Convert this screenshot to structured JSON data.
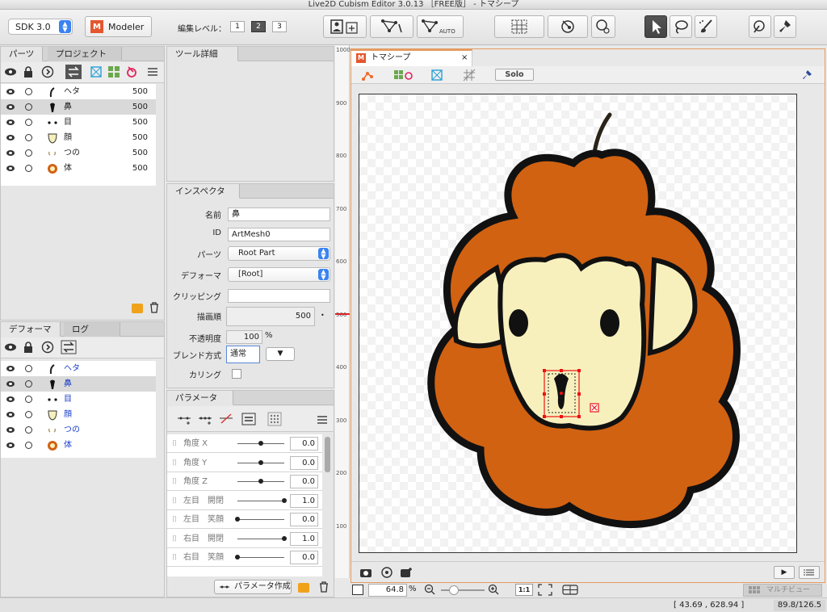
{
  "window": {
    "title": "Live2D Cubism Editor 3.0.13 ［FREE版］ - トマシープ"
  },
  "toolbar": {
    "sdk_value": "SDK 3.0",
    "modeler_label": "Modeler",
    "edit_level_label": "編集レベル：",
    "edit_levels": [
      "1",
      "2",
      "3"
    ],
    "edit_level_selected": "2",
    "auto_label": "AUTO"
  },
  "parts_panel": {
    "tabs": [
      "パーツ",
      "プロジェクト"
    ],
    "items": [
      {
        "name": "ヘタ",
        "value": "500"
      },
      {
        "name": "鼻",
        "value": "500"
      },
      {
        "name": "目",
        "value": "500"
      },
      {
        "name": "顔",
        "value": "500"
      },
      {
        "name": "つの",
        "value": "500"
      },
      {
        "name": "体",
        "value": "500"
      }
    ]
  },
  "tool_detail": {
    "tab": "ツール詳細"
  },
  "inspector": {
    "tab": "インスペクタ",
    "name_label": "名前",
    "name_value": "鼻",
    "id_label": "ID",
    "id_value": "ArtMesh0",
    "part_label": "パーツ",
    "part_value": "Root Part",
    "deformer_label": "デフォーマ",
    "deformer_value": "[Root]",
    "clipping_label": "クリッピング",
    "clipping_value": "",
    "draw_order_label": "描画順",
    "draw_order_value": "500",
    "opacity_label": "不透明度",
    "opacity_value": "100",
    "opacity_unit": "%",
    "blend_label": "ブレンド方式",
    "blend_value": "通常",
    "culling_label": "カリング"
  },
  "deformer_panel": {
    "tabs": [
      "デフォーマ",
      "ログ"
    ],
    "items": [
      {
        "name": "ヘタ"
      },
      {
        "name": "鼻"
      },
      {
        "name": "目"
      },
      {
        "name": "顔"
      },
      {
        "name": "つの"
      },
      {
        "name": "体"
      }
    ]
  },
  "parameter_panel": {
    "tab": "パラメータ",
    "create_label": "パラメータ作成",
    "items": [
      {
        "name": "角度 X",
        "value": "0.0",
        "pos": 0.5
      },
      {
        "name": "角度 Y",
        "value": "0.0",
        "pos": 0.5
      },
      {
        "name": "角度 Z",
        "value": "0.0",
        "pos": 0.5
      },
      {
        "name": "左目　開閉",
        "value": "1.0",
        "pos": 1.0
      },
      {
        "name": "左目　笑顔",
        "value": "0.0",
        "pos": 0.0
      },
      {
        "name": "右目　開閉",
        "value": "1.0",
        "pos": 1.0
      },
      {
        "name": "右目　笑顔",
        "value": "0.0",
        "pos": 0.0
      }
    ]
  },
  "ruler": {
    "labels": [
      "1000",
      "900",
      "800",
      "700",
      "600",
      "500",
      "400",
      "300",
      "200",
      "100"
    ]
  },
  "viewport": {
    "tab_title": "トマシープ",
    "solo_label": "Solo",
    "zoom_value": "64.8",
    "zoom_unit": "%",
    "one_to_one": "1:1",
    "multiview_label": "マルチビュー"
  },
  "status": {
    "coords": "[ 43.69 , 628.94 ]",
    "memory": "89.8/126.5"
  }
}
